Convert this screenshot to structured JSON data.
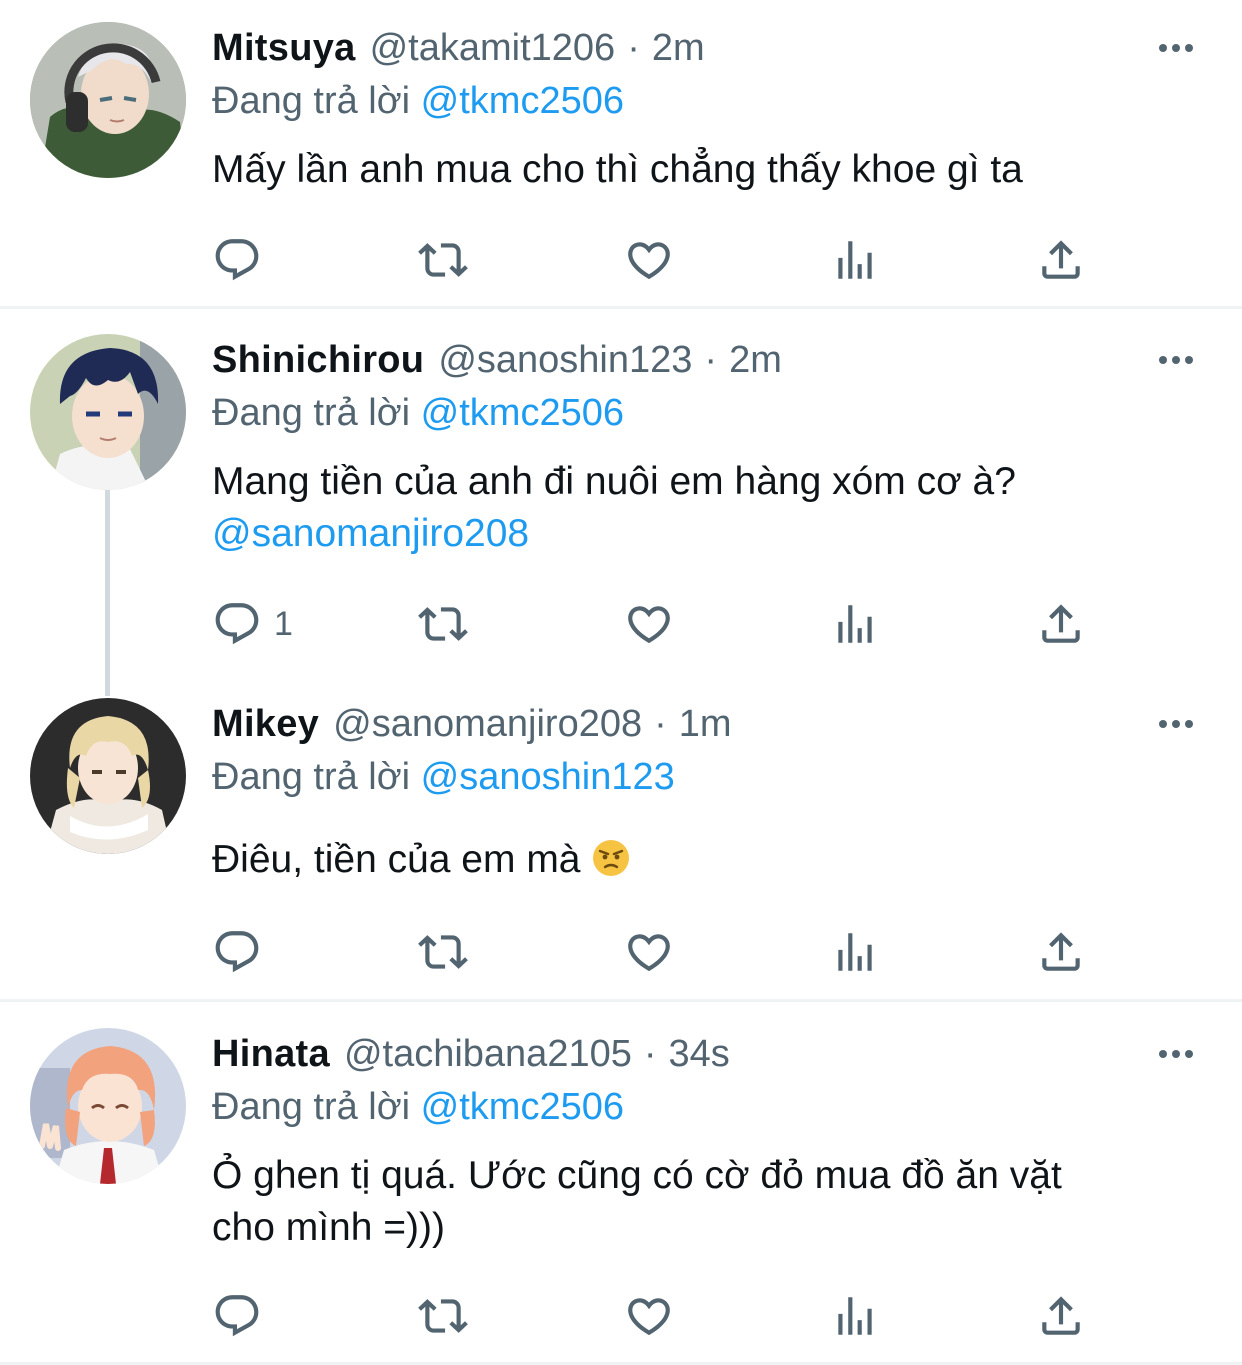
{
  "tweets": [
    {
      "name": "Mitsuya",
      "handle": "@takamit1206",
      "dot": "·",
      "time": "2m",
      "reply_prefix": "Đang trả lời",
      "reply_handle": "@tkmc2506",
      "text": "Mấy lần anh mua cho thì chẳng thấy khoe gì ta",
      "text_mention": "",
      "reply_count": ""
    },
    {
      "name": "Shinichirou",
      "handle": "@sanoshin123",
      "dot": "·",
      "time": "2m",
      "reply_prefix": "Đang trả lời",
      "reply_handle": "@tkmc2506",
      "text": "Mang tiền của anh đi nuôi em hàng xóm cơ à?",
      "text_mention": "@sanomanjiro208",
      "reply_count": "1"
    },
    {
      "name": "Mikey",
      "handle": "@sanomanjiro208",
      "dot": "·",
      "time": "1m",
      "reply_prefix": "Đang trả lời",
      "reply_handle": "@sanoshin123",
      "text": "Điêu, tiền của em mà",
      "text_emoji": "angry-face",
      "text_mention": "",
      "reply_count": ""
    },
    {
      "name": "Hinata",
      "handle": "@tachibana2105",
      "dot": "·",
      "time": "34s",
      "reply_prefix": "Đang trả lời",
      "reply_handle": "@tkmc2506",
      "text_line1": "Ỏ ghen tị quá. Ước cũng có cờ đỏ mua đồ ăn vặt",
      "text_line2": "cho mình =)))",
      "text_mention": "",
      "reply_count": ""
    }
  ],
  "colors": {
    "text": "#0f1419",
    "secondary": "#536471",
    "link": "#1d9bf0",
    "divider": "#eff3f4",
    "thread_line": "#cfd9de"
  },
  "icons": [
    "reply-icon",
    "retweet-icon",
    "like-icon",
    "views-icon",
    "share-icon",
    "more-icon"
  ]
}
